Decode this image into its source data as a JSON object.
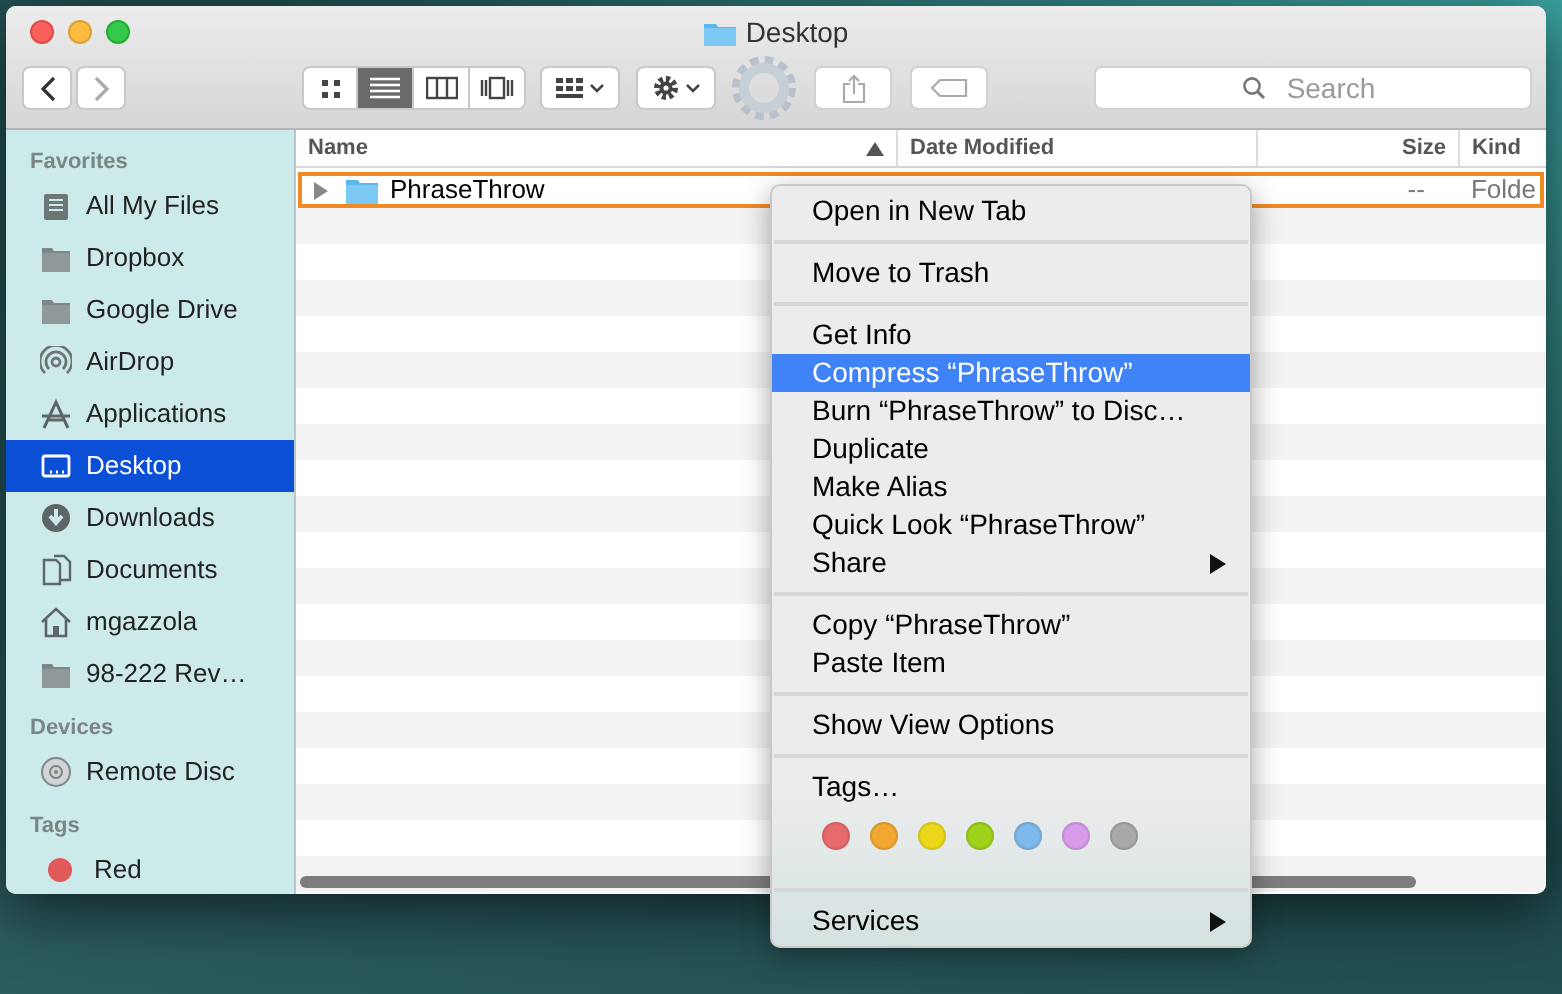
{
  "window": {
    "title": "Desktop"
  },
  "toolbar": {
    "view_buttons": [
      {
        "selected": false
      },
      {
        "selected": true
      },
      {
        "selected": false
      },
      {
        "selected": false
      }
    ],
    "search": {
      "placeholder": "Search"
    }
  },
  "sidebar": {
    "sections": [
      {
        "title": "Favorites",
        "items": [
          {
            "label": "All My Files",
            "selected": false
          },
          {
            "label": "Dropbox",
            "selected": false
          },
          {
            "label": "Google Drive",
            "selected": false
          },
          {
            "label": "AirDrop",
            "selected": false
          },
          {
            "label": "Applications",
            "selected": false
          },
          {
            "label": "Desktop",
            "selected": true
          },
          {
            "label": "Downloads",
            "selected": false
          },
          {
            "label": "Documents",
            "selected": false
          },
          {
            "label": "mgazzola",
            "selected": false
          },
          {
            "label": "98-222 Rev…",
            "selected": false
          }
        ]
      },
      {
        "title": "Devices",
        "items": [
          {
            "label": "Remote Disc",
            "selected": false
          }
        ]
      },
      {
        "title": "Tags",
        "items": [
          {
            "label": "Red",
            "selected": false,
            "color": "#e05a5a"
          }
        ]
      }
    ]
  },
  "table": {
    "columns": [
      {
        "label": "Name",
        "sorted": true
      },
      {
        "label": "Date Modified",
        "sorted": false
      },
      {
        "label": "Size",
        "sorted": false
      },
      {
        "label": "Kind",
        "sorted": false
      }
    ],
    "rows": [
      {
        "name": "PhraseThrow",
        "size": "--",
        "kind": "Folde",
        "context_target": true
      }
    ]
  },
  "context_menu": {
    "groups": [
      {
        "items": [
          {
            "label": "Open in New Tab",
            "selected": false,
            "submenu": false
          }
        ]
      },
      {
        "items": [
          {
            "label": "Move to Trash",
            "selected": false,
            "submenu": false
          }
        ]
      },
      {
        "items": [
          {
            "label": "Get Info",
            "selected": false,
            "submenu": false
          },
          {
            "label": "Compress “PhraseThrow”",
            "selected": true,
            "submenu": false
          },
          {
            "label": "Burn “PhraseThrow” to Disc…",
            "selected": false,
            "submenu": false
          },
          {
            "label": "Duplicate",
            "selected": false,
            "submenu": false
          },
          {
            "label": "Make Alias",
            "selected": false,
            "submenu": false
          },
          {
            "label": "Quick Look “PhraseThrow”",
            "selected": false,
            "submenu": false
          },
          {
            "label": "Share",
            "selected": false,
            "submenu": true
          }
        ]
      },
      {
        "items": [
          {
            "label": "Copy “PhraseThrow”",
            "selected": false,
            "submenu": false
          },
          {
            "label": "Paste Item",
            "selected": false,
            "submenu": false
          }
        ]
      },
      {
        "items": [
          {
            "label": "Show View Options",
            "selected": false,
            "submenu": false
          }
        ]
      },
      {
        "items": [
          {
            "label": "Tags…",
            "selected": false,
            "submenu": false
          }
        ],
        "tag_colors": [
          {
            "color": "#e86b6b"
          },
          {
            "color": "#f0a830"
          },
          {
            "color": "#ecd81a"
          },
          {
            "color": "#9fd11a"
          },
          {
            "color": "#7eb8ea"
          },
          {
            "color": "#d99cea"
          },
          {
            "color": "#a8a8a8"
          }
        ]
      },
      {
        "items": [
          {
            "label": "Services",
            "selected": false,
            "submenu": true
          }
        ]
      }
    ]
  }
}
